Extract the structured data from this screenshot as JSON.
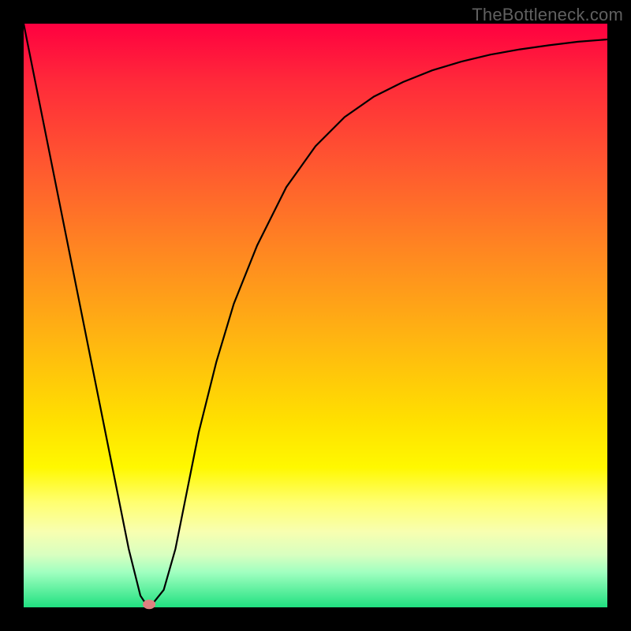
{
  "watermark": "TheBottleneck.com",
  "chart_data": {
    "type": "line",
    "title": "",
    "xlabel": "",
    "ylabel": "",
    "xlim": [
      0,
      100
    ],
    "ylim": [
      0,
      100
    ],
    "grid": false,
    "background": "red-yellow-green vertical gradient",
    "series": [
      {
        "name": "curve",
        "x": [
          0,
          5,
          10,
          15,
          18,
          20,
          21,
          22,
          24,
          26,
          28,
          30,
          33,
          36,
          40,
          45,
          50,
          55,
          60,
          65,
          70,
          75,
          80,
          85,
          90,
          95,
          100
        ],
        "y": [
          100,
          75,
          50,
          25,
          10,
          2,
          0.5,
          0.5,
          3,
          10,
          20,
          30,
          42,
          52,
          62,
          72,
          79,
          84,
          87.5,
          90,
          92,
          93.5,
          94.7,
          95.6,
          96.3,
          96.9,
          97.3
        ],
        "color": "#000000"
      }
    ],
    "markers": [
      {
        "name": "min-point",
        "x": 21.5,
        "y": 0.5,
        "color": "#e08080",
        "shape": "ellipse"
      }
    ]
  }
}
